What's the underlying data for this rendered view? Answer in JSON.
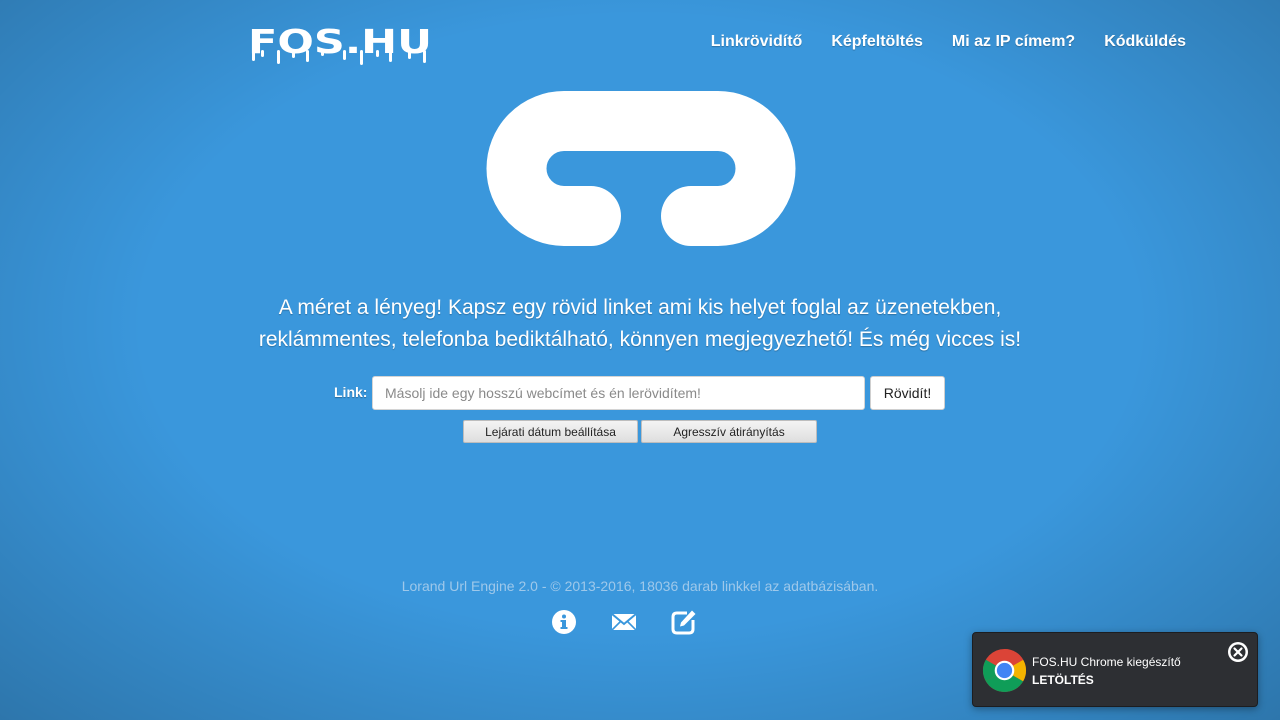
{
  "header": {
    "logo_text": "FOS.HU",
    "nav": [
      {
        "label": "Linkrövidítő"
      },
      {
        "label": "Képfeltöltés"
      },
      {
        "label": "Mi az IP címem?"
      },
      {
        "label": "Kódküldés"
      }
    ]
  },
  "main": {
    "hero_icon": "chain-link-icon",
    "tagline_line1": "A méret a lényeg! Kapsz egy rövid linket ami kis helyet foglal az üzenetekben,",
    "tagline_line2": "reklámmentes, telefonba bediktálható, könnyen megjegyezhető! És még vicces is!",
    "form": {
      "label": "Link:",
      "input_value": "",
      "placeholder": "Másolj ide egy hosszú webcímet és én lerövidítem!",
      "submit_label": "Rövidít!",
      "option_expiry_label": "Lejárati dátum beállítása",
      "option_redirect_label": "Agresszív átirányítás"
    }
  },
  "footer": {
    "text": "Lorand Url Engine 2.0 - © 2013-2016, 18036 darab linkkel az adatbázisában.",
    "icons": [
      "info-icon",
      "mail-icon",
      "edit-icon"
    ]
  },
  "toast": {
    "title": "FOS.HU Chrome kiegészítő",
    "action": "LETÖLTÉS",
    "icons": [
      "chrome-icon",
      "close-icon"
    ]
  },
  "colors": {
    "background": "#3a97dc",
    "text": "#ffffff",
    "footer_text": "#9ec8ea",
    "toast_background": "#2d2f33"
  }
}
